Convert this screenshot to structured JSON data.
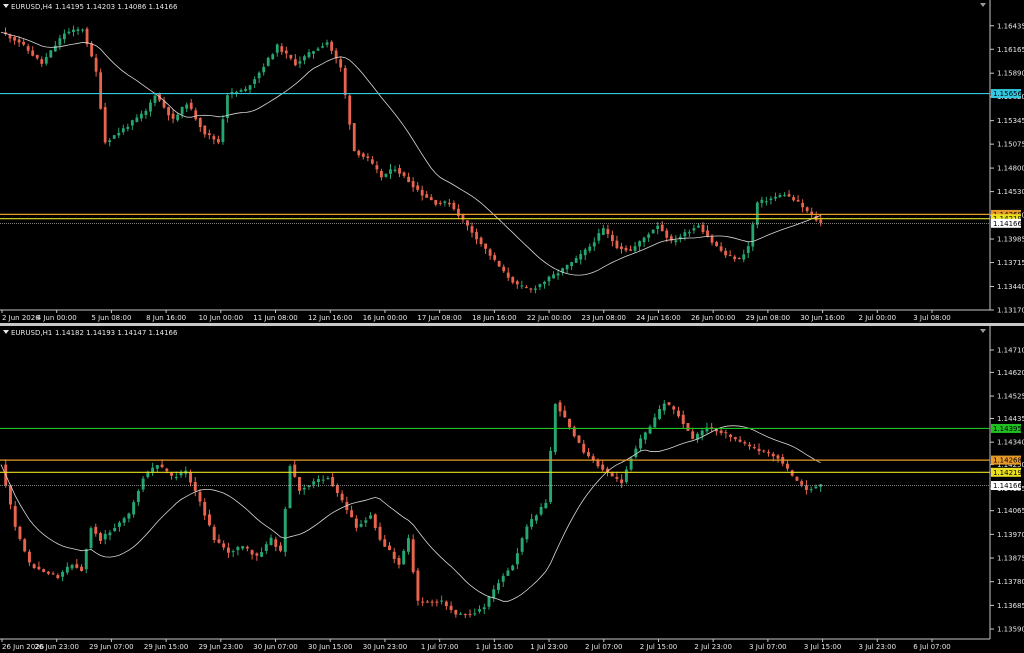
{
  "colors": {
    "background": "#000000",
    "bull": "#26a671",
    "bear": "#e8644e",
    "ma": "#d8d8d8",
    "axis": "#c8c8c8"
  },
  "chart_data": [
    {
      "type": "candlestick",
      "title": "EURUSD,H4",
      "ohlc_header": "1.14195 1.14203 1.14086 1.14166",
      "y_ticks": [
        "1.16435",
        "1.16165",
        "1.15890",
        "1.15620",
        "1.15345",
        "1.15075",
        "1.14800",
        "1.14530",
        "1.14260",
        "1.13985",
        "1.13715",
        "1.13440",
        "1.13170"
      ],
      "ylim": [
        1.1317,
        1.1657
      ],
      "x_ticks": [
        "2 Jun 2026",
        "4 Jun 00:00",
        "5 Jun 08:00",
        "8 Jun 16:00",
        "10 Jun 00:00",
        "11 Jun 08:00",
        "12 Jun 16:00",
        "16 Jun 00:00",
        "17 Jun 08:00",
        "18 Jun 16:00",
        "22 Jun 00:00",
        "23 Jun 08:00",
        "24 Jun 16:00",
        "26 Jun 00:00",
        "29 Jun 08:00",
        "30 Jun 16:00",
        "2 Jul 00:00",
        "3 Jul 08:00"
      ],
      "levels": [
        {
          "price": 1.15656,
          "label": "1.15656",
          "color": "#34c8e0"
        },
        {
          "price": 1.14268,
          "label": "1.14268",
          "color": "#e89a2a"
        },
        {
          "price": 1.14219,
          "label": "1.14219",
          "color": "#e8e020"
        },
        {
          "price": 1.14166,
          "label": "1.14166",
          "color": "#c8c8c8"
        }
      ],
      "anchors": [
        [
          0,
          1.1636
        ],
        [
          4,
          1.1625
        ],
        [
          9,
          1.16
        ],
        [
          14,
          1.1635
        ],
        [
          18,
          1.164
        ],
        [
          21,
          1.159
        ],
        [
          23,
          1.151
        ],
        [
          27,
          1.1525
        ],
        [
          32,
          1.1545
        ],
        [
          34,
          1.1565
        ],
        [
          38,
          1.1535
        ],
        [
          41,
          1.1555
        ],
        [
          45,
          1.152
        ],
        [
          48,
          1.151
        ],
        [
          50,
          1.1565
        ],
        [
          54,
          1.157
        ],
        [
          57,
          1.159
        ],
        [
          61,
          1.162
        ],
        [
          65,
          1.16
        ],
        [
          69,
          1.1615
        ],
        [
          72,
          1.1625
        ],
        [
          75,
          1.1595
        ],
        [
          78,
          1.15
        ],
        [
          81,
          1.149
        ],
        [
          84,
          1.147
        ],
        [
          87,
          1.148
        ],
        [
          90,
          1.1465
        ],
        [
          93,
          1.145
        ],
        [
          96,
          1.144
        ],
        [
          99,
          1.144
        ],
        [
          102,
          1.142
        ],
        [
          105,
          1.14
        ],
        [
          108,
          1.138
        ],
        [
          111,
          1.136
        ],
        [
          114,
          1.1345
        ],
        [
          117,
          1.134
        ],
        [
          120,
          1.135
        ],
        [
          123,
          1.136
        ],
        [
          127,
          1.1375
        ],
        [
          130,
          1.139
        ],
        [
          133,
          1.141
        ],
        [
          136,
          1.139
        ],
        [
          139,
          1.1385
        ],
        [
          142,
          1.14
        ],
        [
          145,
          1.1415
        ],
        [
          148,
          1.1395
        ],
        [
          151,
          1.1405
        ],
        [
          154,
          1.1415
        ],
        [
          157,
          1.1395
        ],
        [
          160,
          1.138
        ],
        [
          163,
          1.1375
        ],
        [
          165,
          1.139
        ],
        [
          167,
          1.144
        ],
        [
          170,
          1.1445
        ],
        [
          173,
          1.145
        ],
        [
          176,
          1.144
        ],
        [
          179,
          1.1425
        ],
        [
          181,
          1.14166
        ]
      ],
      "ma_period": 20
    },
    {
      "type": "candlestick",
      "title": "EURUSD,H1",
      "ohlc_header": "1.14182 1.14193 1.14147 1.14166",
      "y_ticks": [
        "1.14710",
        "1.14620",
        "1.14525",
        "1.14435",
        "1.14340",
        "1.14250",
        "1.14155",
        "1.14065",
        "1.13970",
        "1.13875",
        "1.13780",
        "1.13685",
        "1.13590"
      ],
      "ylim": [
        1.1355,
        1.1475
      ],
      "x_ticks": [
        "26 Jun 2026",
        "26 Jun 23:00",
        "29 Jun 07:00",
        "29 Jun 15:00",
        "29 Jun 23:00",
        "30 Jun 07:00",
        "30 Jun 15:00",
        "30 Jun 23:00",
        "1 Jul 07:00",
        "1 Jul 15:00",
        "1 Jul 23:00",
        "2 Jul 07:00",
        "2 Jul 15:00",
        "2 Jul 23:00",
        "3 Jul 07:00",
        "3 Jul 15:00",
        "3 Jul 23:00",
        "6 Jul 07:00"
      ],
      "levels": [
        {
          "price": 1.14395,
          "label": "1.14395",
          "color": "#20c020"
        },
        {
          "price": 1.14268,
          "label": "1.14268",
          "color": "#e89a2a"
        },
        {
          "price": 1.14219,
          "label": "1.14219",
          "color": "#e8e020"
        },
        {
          "price": 1.14166,
          "label": "1.14166",
          "color": "#c8c8c8"
        }
      ],
      "anchors": [
        [
          0,
          1.1425
        ],
        [
          3,
          1.14
        ],
        [
          6,
          1.1385
        ],
        [
          9,
          1.1382
        ],
        [
          12,
          1.138
        ],
        [
          15,
          1.1385
        ],
        [
          17,
          1.1383
        ],
        [
          19,
          1.14
        ],
        [
          21,
          1.1395
        ],
        [
          24,
          1.14
        ],
        [
          27,
          1.1405
        ],
        [
          30,
          1.142
        ],
        [
          33,
          1.1425
        ],
        [
          36,
          1.142
        ],
        [
          39,
          1.1422
        ],
        [
          42,
          1.141
        ],
        [
          45,
          1.1395
        ],
        [
          48,
          1.139
        ],
        [
          51,
          1.1392
        ],
        [
          54,
          1.1388
        ],
        [
          57,
          1.1395
        ],
        [
          59,
          1.139
        ],
        [
          61,
          1.1425
        ],
        [
          63,
          1.1415
        ],
        [
          66,
          1.1418
        ],
        [
          69,
          1.142
        ],
        [
          72,
          1.141
        ],
        [
          75,
          1.14
        ],
        [
          78,
          1.1405
        ],
        [
          80,
          1.1395
        ],
        [
          82,
          1.139
        ],
        [
          84,
          1.1385
        ],
        [
          86,
          1.1395
        ],
        [
          88,
          1.137
        ],
        [
          90,
          1.137
        ],
        [
          93,
          1.137
        ],
        [
          96,
          1.1365
        ],
        [
          99,
          1.1365
        ],
        [
          102,
          1.1368
        ],
        [
          105,
          1.1378
        ],
        [
          108,
          1.1385
        ],
        [
          111,
          1.14
        ],
        [
          113,
          1.1405
        ],
        [
          115,
          1.141
        ],
        [
          117,
          1.145
        ],
        [
          120,
          1.144
        ],
        [
          123,
          1.143
        ],
        [
          126,
          1.1425
        ],
        [
          129,
          1.142
        ],
        [
          131,
          1.1418
        ],
        [
          133,
          1.1428
        ],
        [
          135,
          1.1435
        ],
        [
          137,
          1.144
        ],
        [
          140,
          1.145
        ],
        [
          143,
          1.1445
        ],
        [
          146,
          1.1435
        ],
        [
          149,
          1.144
        ],
        [
          152,
          1.1438
        ],
        [
          155,
          1.1435
        ],
        [
          158,
          1.1432
        ],
        [
          161,
          1.143
        ],
        [
          164,
          1.1428
        ],
        [
          167,
          1.142
        ],
        [
          170,
          1.1415
        ],
        [
          173,
          1.14166
        ]
      ],
      "ma_period": 20
    }
  ]
}
